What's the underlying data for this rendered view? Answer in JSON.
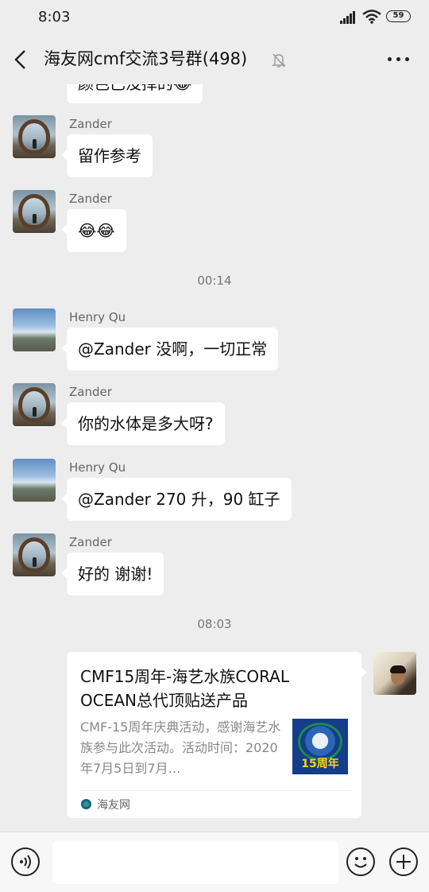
{
  "status_bar": {
    "time": "8:03",
    "battery": "59"
  },
  "header": {
    "title": "海友网cmf交流3号群(498)"
  },
  "chat": {
    "partial_message": "颜色已没择的😂",
    "messages": [
      {
        "sender": "Zander",
        "text": "留作参考"
      },
      {
        "sender": "Zander",
        "text": "😂😂"
      },
      {
        "timestamp": "00:14"
      },
      {
        "sender": "Henry Qu",
        "text": "@Zander  没啊，一切正常"
      },
      {
        "sender": "Zander",
        "text": "你的水体是多大呀?"
      },
      {
        "sender": "Henry Qu",
        "text": "@Zander 270 升，90 缸子"
      },
      {
        "sender": "Zander",
        "text": "好的 谢谢!"
      },
      {
        "timestamp": "08:03"
      }
    ],
    "link_card": {
      "title": "CMF15周年-海艺水族CORAL OCEAN总代顶贴送产品",
      "description": "CMF-15周年庆典活动，感谢海艺水族参与此次活动。活动时间：2020年7月5日到7月…",
      "thumbnail_label": "15周年",
      "source": "海友网"
    }
  },
  "input_bar": {
    "placeholder": ""
  }
}
